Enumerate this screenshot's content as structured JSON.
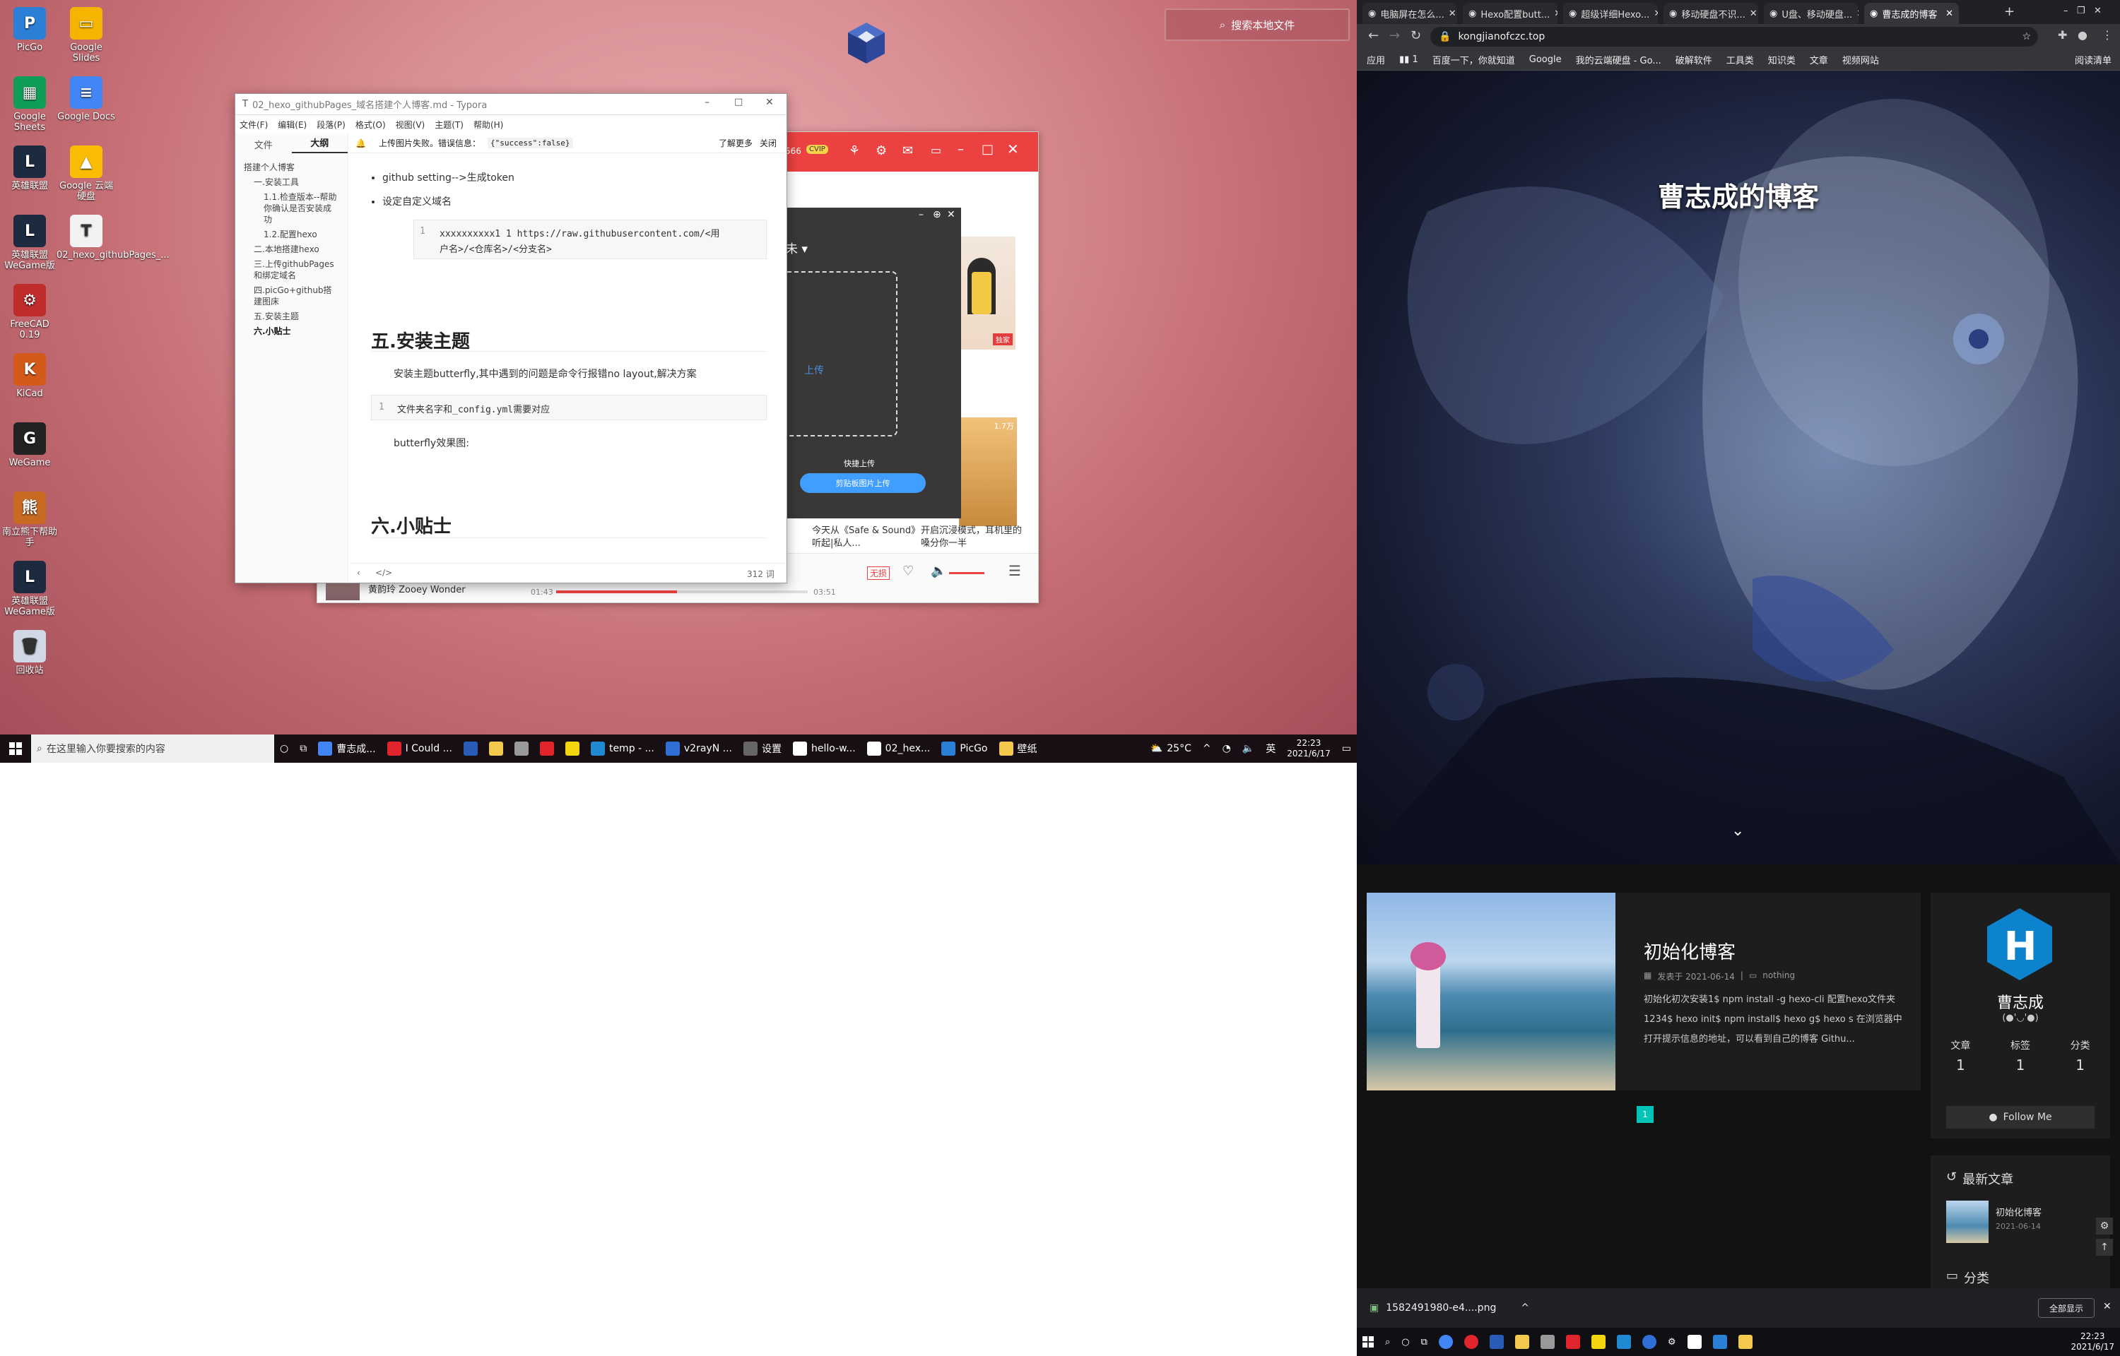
{
  "desktop": {
    "icons": [
      {
        "label": "PicGo",
        "color": "#2b7fd6",
        "glyph": "P"
      },
      {
        "label": "Google Slides",
        "color": "#f4b400",
        "glyph": "▭"
      },
      {
        "label": "Google Sheets",
        "color": "#0f9d58",
        "glyph": "▦"
      },
      {
        "label": "Google Docs",
        "color": "#4285f4",
        "glyph": "≡"
      },
      {
        "label": "英雄联盟",
        "color": "#1c2b40",
        "glyph": "L"
      },
      {
        "label": "Google 云端硬盘",
        "color": "#fbbc04",
        "glyph": "▲"
      },
      {
        "label": "英雄联盟WeGame版",
        "color": "#1c2b40",
        "glyph": "L"
      },
      {
        "label": "02_hexo_githubPages_...",
        "color": "#f2f2f2",
        "glyph": "T"
      },
      {
        "label": "FreeCAD 0.19",
        "color": "#c02c2c",
        "glyph": "⚙"
      },
      {
        "label": "KiCad",
        "color": "#d45a1a",
        "glyph": "K"
      },
      {
        "label": "WeGame",
        "color": "#222",
        "glyph": "G"
      },
      {
        "label": "南立熊下帮助手",
        "color": "#c96a22",
        "glyph": "熊"
      },
      {
        "label": "英雄联盟WeGame版",
        "color": "#1c2b40",
        "glyph": "L"
      },
      {
        "label": "回收站",
        "color": "#cfd8e4",
        "glyph": "🗑"
      }
    ],
    "search_local": "搜索本地文件"
  },
  "typora": {
    "title": "02_hexo_githubPages_域名搭建个人博客.md - Typora",
    "menu": [
      "文件(F)",
      "编辑(E)",
      "段落(P)",
      "格式(O)",
      "视图(V)",
      "主题(T)",
      "帮助(H)"
    ],
    "side_tabs": [
      "文件",
      "大纲"
    ],
    "outline": [
      "搭建个人博客",
      "一.安装工具",
      "1.1.检查版本--帮助你确认是否安装成功",
      "1.2.配置hexo",
      "二.本地搭建hexo",
      "三.上传githubPages和绑定域名",
      "四.picGo+github搭建图床",
      "五.安装主题",
      "六.小贴士"
    ],
    "notice": "上传图片失败。错误信息：",
    "notice_code": "{\"success\":false}",
    "notice_more": "了解更多",
    "notice_close": "关闭",
    "bullets": [
      "github setting-->生成token",
      "设定自定义域名"
    ],
    "code1_num": "1",
    "code1_line1": "xxxxxxxxxx1 1 https://raw.githubusercontent.com/<用",
    "code1_line2": "户名>/<仓库名>/<分支名>",
    "h5": "五.安装主题",
    "p1": "安装主题butterfly,其中遇到的问题是命令行报错no layout,解决方案",
    "code2_num": "1",
    "code2": "文件夹名字和_config.yml需要对应",
    "p2": "butterfly效果图:",
    "h6": "六.小贴士",
    "wordcount": "312 词"
  },
  "music": {
    "number": "566",
    "badge": "CVIP",
    "tag": "独家",
    "player_song": "黄韵玲 Zooey Wonder",
    "time_cur": "01:43",
    "time_total": "03:51",
    "quality": "无损",
    "caption1": "今天从《Safe & Sound》听起|私人...",
    "caption2": "开启沉浸模式，耳机里的嗓分你一半",
    "thumb_num": "1.7万",
    "progress": 0.48
  },
  "upload_dialog": {
    "quick": "快捷上传",
    "btn": "剪贴板图片上传",
    "link": "上传",
    "arrow": "未 ▾"
  },
  "taskbar1": {
    "search": "在这里输入你要搜索的内容",
    "apps": [
      {
        "label": "曹志成...",
        "color": "#4285f4"
      },
      {
        "label": "I Could ...",
        "color": "#e0252d"
      },
      {
        "label": "",
        "color": "#2a5bb6"
      },
      {
        "label": "",
        "color": "#f2c94c"
      },
      {
        "label": "",
        "color": "#999"
      },
      {
        "label": "",
        "color": "#e0252d"
      },
      {
        "label": "",
        "color": "#f2d50c"
      },
      {
        "label": "temp - ...",
        "color": "#1f8ad2"
      },
      {
        "label": "v2rayN ...",
        "color": "#2f6fd6"
      },
      {
        "label": "设置",
        "color": "#666"
      },
      {
        "label": "hello-w...",
        "color": "#fff"
      },
      {
        "label": "02_hex...",
        "color": "#fff"
      },
      {
        "label": "PicGo",
        "color": "#2b7fd6"
      },
      {
        "label": "壁纸",
        "color": "#f2c94c"
      }
    ],
    "weather": "25°C",
    "ime": "英",
    "time": "22:23",
    "date": "2021/6/17"
  },
  "chrome": {
    "tabs": [
      "电脑屏在怎么...",
      "Hexo配置butt...",
      "超级详细Hexo...",
      "移动硬盘不识...",
      "U盘、移动硬盘...",
      "曹志成的博客"
    ],
    "url": "kongjianofczc.top",
    "bookmarks": [
      "应用",
      "▮▮ 1",
      "百度一下，你就知道",
      "Google",
      "我的云端硬盘 - Go...",
      "破解软件",
      "工具类",
      "知识类",
      "文章",
      "视频网站"
    ],
    "reading_list": "阅读清单"
  },
  "blog": {
    "site_title": "曹志成的博客",
    "post_title": "初始化博客",
    "post_date": "发表于 2021-06-14",
    "post_cat": "nothing",
    "post_excerpt": "初始化初次安装1$ npm install -g hexo-cli 配置hexo文件夹1234$ hexo init$ npm install$ hexo g$ hexo s 在浏览器中打开提示信息的地址，可以看到自己的博客 Githu...",
    "page": "1",
    "author": "曹志成",
    "author_sub": "(●'◡'●)",
    "stats": [
      {
        "label": "文章",
        "value": "1"
      },
      {
        "label": "标签",
        "value": "1"
      },
      {
        "label": "分类",
        "value": "1"
      }
    ],
    "follow": "Follow Me",
    "recent_title": "最新文章",
    "recent_post": "初始化博客",
    "recent_date": "2021-06-14",
    "categories": "分类",
    "avatar_letter": "H"
  },
  "downloads": {
    "file": "1582491980-e4....png",
    "show_all": "全部显示"
  },
  "taskbar2": {
    "time": "22:23",
    "date": "2021/6/17"
  }
}
